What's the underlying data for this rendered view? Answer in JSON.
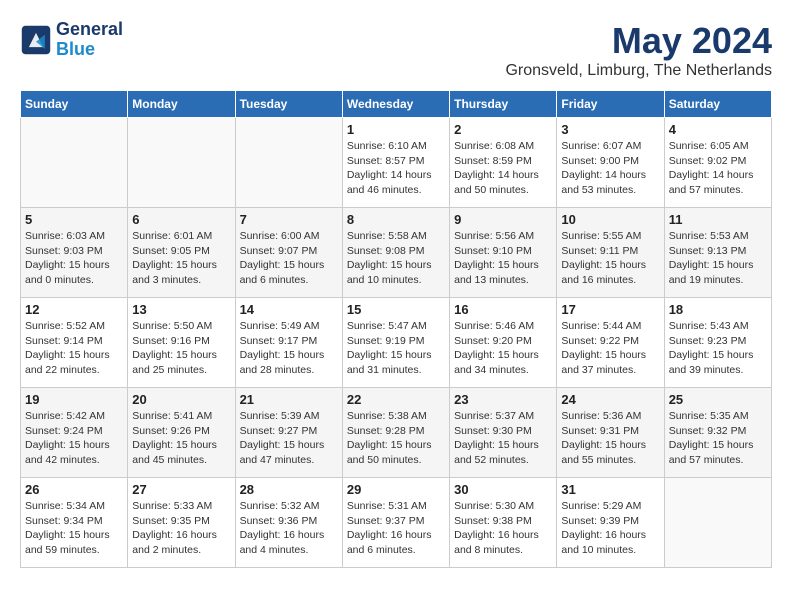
{
  "header": {
    "logo_line1": "General",
    "logo_line2": "Blue",
    "month": "May 2024",
    "location": "Gronsveld, Limburg, The Netherlands"
  },
  "weekdays": [
    "Sunday",
    "Monday",
    "Tuesday",
    "Wednesday",
    "Thursday",
    "Friday",
    "Saturday"
  ],
  "weeks": [
    [
      {
        "day": "",
        "info": ""
      },
      {
        "day": "",
        "info": ""
      },
      {
        "day": "",
        "info": ""
      },
      {
        "day": "1",
        "info": "Sunrise: 6:10 AM\nSunset: 8:57 PM\nDaylight: 14 hours\nand 46 minutes."
      },
      {
        "day": "2",
        "info": "Sunrise: 6:08 AM\nSunset: 8:59 PM\nDaylight: 14 hours\nand 50 minutes."
      },
      {
        "day": "3",
        "info": "Sunrise: 6:07 AM\nSunset: 9:00 PM\nDaylight: 14 hours\nand 53 minutes."
      },
      {
        "day": "4",
        "info": "Sunrise: 6:05 AM\nSunset: 9:02 PM\nDaylight: 14 hours\nand 57 minutes."
      }
    ],
    [
      {
        "day": "5",
        "info": "Sunrise: 6:03 AM\nSunset: 9:03 PM\nDaylight: 15 hours\nand 0 minutes."
      },
      {
        "day": "6",
        "info": "Sunrise: 6:01 AM\nSunset: 9:05 PM\nDaylight: 15 hours\nand 3 minutes."
      },
      {
        "day": "7",
        "info": "Sunrise: 6:00 AM\nSunset: 9:07 PM\nDaylight: 15 hours\nand 6 minutes."
      },
      {
        "day": "8",
        "info": "Sunrise: 5:58 AM\nSunset: 9:08 PM\nDaylight: 15 hours\nand 10 minutes."
      },
      {
        "day": "9",
        "info": "Sunrise: 5:56 AM\nSunset: 9:10 PM\nDaylight: 15 hours\nand 13 minutes."
      },
      {
        "day": "10",
        "info": "Sunrise: 5:55 AM\nSunset: 9:11 PM\nDaylight: 15 hours\nand 16 minutes."
      },
      {
        "day": "11",
        "info": "Sunrise: 5:53 AM\nSunset: 9:13 PM\nDaylight: 15 hours\nand 19 minutes."
      }
    ],
    [
      {
        "day": "12",
        "info": "Sunrise: 5:52 AM\nSunset: 9:14 PM\nDaylight: 15 hours\nand 22 minutes."
      },
      {
        "day": "13",
        "info": "Sunrise: 5:50 AM\nSunset: 9:16 PM\nDaylight: 15 hours\nand 25 minutes."
      },
      {
        "day": "14",
        "info": "Sunrise: 5:49 AM\nSunset: 9:17 PM\nDaylight: 15 hours\nand 28 minutes."
      },
      {
        "day": "15",
        "info": "Sunrise: 5:47 AM\nSunset: 9:19 PM\nDaylight: 15 hours\nand 31 minutes."
      },
      {
        "day": "16",
        "info": "Sunrise: 5:46 AM\nSunset: 9:20 PM\nDaylight: 15 hours\nand 34 minutes."
      },
      {
        "day": "17",
        "info": "Sunrise: 5:44 AM\nSunset: 9:22 PM\nDaylight: 15 hours\nand 37 minutes."
      },
      {
        "day": "18",
        "info": "Sunrise: 5:43 AM\nSunset: 9:23 PM\nDaylight: 15 hours\nand 39 minutes."
      }
    ],
    [
      {
        "day": "19",
        "info": "Sunrise: 5:42 AM\nSunset: 9:24 PM\nDaylight: 15 hours\nand 42 minutes."
      },
      {
        "day": "20",
        "info": "Sunrise: 5:41 AM\nSunset: 9:26 PM\nDaylight: 15 hours\nand 45 minutes."
      },
      {
        "day": "21",
        "info": "Sunrise: 5:39 AM\nSunset: 9:27 PM\nDaylight: 15 hours\nand 47 minutes."
      },
      {
        "day": "22",
        "info": "Sunrise: 5:38 AM\nSunset: 9:28 PM\nDaylight: 15 hours\nand 50 minutes."
      },
      {
        "day": "23",
        "info": "Sunrise: 5:37 AM\nSunset: 9:30 PM\nDaylight: 15 hours\nand 52 minutes."
      },
      {
        "day": "24",
        "info": "Sunrise: 5:36 AM\nSunset: 9:31 PM\nDaylight: 15 hours\nand 55 minutes."
      },
      {
        "day": "25",
        "info": "Sunrise: 5:35 AM\nSunset: 9:32 PM\nDaylight: 15 hours\nand 57 minutes."
      }
    ],
    [
      {
        "day": "26",
        "info": "Sunrise: 5:34 AM\nSunset: 9:34 PM\nDaylight: 15 hours\nand 59 minutes."
      },
      {
        "day": "27",
        "info": "Sunrise: 5:33 AM\nSunset: 9:35 PM\nDaylight: 16 hours\nand 2 minutes."
      },
      {
        "day": "28",
        "info": "Sunrise: 5:32 AM\nSunset: 9:36 PM\nDaylight: 16 hours\nand 4 minutes."
      },
      {
        "day": "29",
        "info": "Sunrise: 5:31 AM\nSunset: 9:37 PM\nDaylight: 16 hours\nand 6 minutes."
      },
      {
        "day": "30",
        "info": "Sunrise: 5:30 AM\nSunset: 9:38 PM\nDaylight: 16 hours\nand 8 minutes."
      },
      {
        "day": "31",
        "info": "Sunrise: 5:29 AM\nSunset: 9:39 PM\nDaylight: 16 hours\nand 10 minutes."
      },
      {
        "day": "",
        "info": ""
      }
    ]
  ]
}
